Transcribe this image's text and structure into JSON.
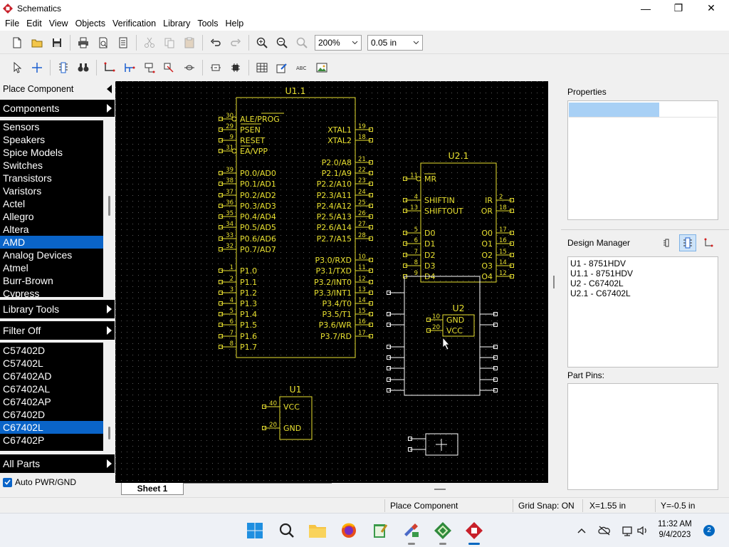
{
  "window": {
    "title": "Schematics",
    "minimize": "—",
    "maximize": "❐",
    "close": "✕"
  },
  "menu": [
    "File",
    "Edit",
    "View",
    "Objects",
    "Verification",
    "Library",
    "Tools",
    "Help"
  ],
  "toolbar": {
    "zoom_value": "200%",
    "grid_value": "0.05 in"
  },
  "left_panel": {
    "place_component": "Place Component",
    "components_header": "Components",
    "categories": [
      "Sensors",
      "Speakers",
      "Spice Models",
      "Switches",
      "Transistors",
      "Varistors",
      "Actel",
      "Allegro",
      "Altera",
      "AMD",
      "Analog Devices",
      "Atmel",
      "Burr-Brown",
      "Cypress"
    ],
    "selected_category": "AMD",
    "library_tools": "Library Tools",
    "filter_off": "Filter Off",
    "parts": [
      "C57402D",
      "C57402L",
      "C67402AD",
      "C67402AL",
      "C67402AP",
      "C67402D",
      "C67402L",
      "C67402P"
    ],
    "selected_part": "C67402L",
    "all_parts": "All Parts",
    "auto_pwr_gnd": "Auto PWR/GND",
    "auto_pwr_gnd_checked": true
  },
  "schematic": {
    "u1_1": {
      "ref": "U1.1",
      "left_pins": [
        {
          "num": "30",
          "name": "ALE/PROG"
        },
        {
          "num": "29",
          "name": "PSEN"
        },
        {
          "num": "9",
          "name": "RESET"
        },
        {
          "num": "31",
          "name": "EA/VPP"
        },
        {
          "num": "39",
          "name": "P0.0/AD0"
        },
        {
          "num": "38",
          "name": "P0.1/AD1"
        },
        {
          "num": "37",
          "name": "P0.2/AD2"
        },
        {
          "num": "36",
          "name": "P0.3/AD3"
        },
        {
          "num": "35",
          "name": "P0.4/AD4"
        },
        {
          "num": "34",
          "name": "P0.5/AD5"
        },
        {
          "num": "33",
          "name": "P0.6/AD6"
        },
        {
          "num": "32",
          "name": "P0.7/AD7"
        },
        {
          "num": "1",
          "name": "P1.0"
        },
        {
          "num": "2",
          "name": "P1.1"
        },
        {
          "num": "3",
          "name": "P1.2"
        },
        {
          "num": "4",
          "name": "P1.3"
        },
        {
          "num": "5",
          "name": "P1.4"
        },
        {
          "num": "6",
          "name": "P1.5"
        },
        {
          "num": "7",
          "name": "P1.6"
        },
        {
          "num": "8",
          "name": "P1.7"
        }
      ],
      "right_pins": [
        {
          "num": "19",
          "name": "XTAL1"
        },
        {
          "num": "18",
          "name": "XTAL2"
        },
        {
          "num": "21",
          "name": "P2.0/A8"
        },
        {
          "num": "22",
          "name": "P2.1/A9"
        },
        {
          "num": "23",
          "name": "P2.2/A10"
        },
        {
          "num": "24",
          "name": "P2.3/A11"
        },
        {
          "num": "25",
          "name": "P2.4/A12"
        },
        {
          "num": "26",
          "name": "P2.5/A13"
        },
        {
          "num": "27",
          "name": "P2.6/A14"
        },
        {
          "num": "28",
          "name": "P2.7/A15"
        },
        {
          "num": "10",
          "name": "P3.0/RXD"
        },
        {
          "num": "11",
          "name": "P3.1/TXD"
        },
        {
          "num": "12",
          "name": "P3.2/INT0"
        },
        {
          "num": "13",
          "name": "P3.3/INT1"
        },
        {
          "num": "14",
          "name": "P3.4/T0"
        },
        {
          "num": "15",
          "name": "P3.5/T1"
        },
        {
          "num": "16",
          "name": "P3.6/WR"
        },
        {
          "num": "17",
          "name": "P3.7/RD"
        }
      ]
    },
    "u1": {
      "ref": "U1",
      "pins": [
        {
          "num": "40",
          "name": "VCC"
        },
        {
          "num": "20",
          "name": "GND"
        }
      ]
    },
    "u2_1": {
      "ref": "U2.1",
      "left_pins": [
        {
          "num": "11",
          "name": "MR"
        },
        {
          "num": "4",
          "name": "SHIFTIN"
        },
        {
          "num": "13",
          "name": "SHIFTOUT"
        },
        {
          "num": "5",
          "name": "D0"
        },
        {
          "num": "6",
          "name": "D1"
        },
        {
          "num": "7",
          "name": "D2"
        },
        {
          "num": "8",
          "name": "D3"
        },
        {
          "num": "9",
          "name": "D4"
        }
      ],
      "right_pins": [
        {
          "num": "2",
          "name": "IR"
        },
        {
          "num": "18",
          "name": "OR"
        },
        {
          "num": "17",
          "name": "O0"
        },
        {
          "num": "16",
          "name": "O1"
        },
        {
          "num": "15",
          "name": "O2"
        },
        {
          "num": "14",
          "name": "O3"
        },
        {
          "num": "12",
          "name": "O4"
        }
      ]
    },
    "u2": {
      "ref": "U2",
      "pins": [
        {
          "num": "10",
          "name": "GND"
        },
        {
          "num": "20",
          "name": "VCC"
        }
      ]
    }
  },
  "sheet_tab": "Sheet 1",
  "right_panel": {
    "properties_title": "Properties",
    "design_manager_title": "Design Manager",
    "design_items": [
      "U1 - 8751HDV",
      "U1.1 - 8751HDV",
      "U2 - C67402L",
      "U2.1 - C67402L"
    ],
    "part_pins_title": "Part Pins:"
  },
  "status": {
    "mode": "Place Component",
    "grid_snap": "Grid Snap: ON",
    "x": "X=1.55 in",
    "y": "Y=-0.5 in"
  },
  "taskbar": {
    "time": "11:32 AM",
    "date": "9/4/2023",
    "notifications": "2"
  },
  "colors": {
    "schematic_fg": "#e8e030",
    "canvas_bg": "#000000",
    "selection": "#0a64c8",
    "placing_part": "#ffffff"
  }
}
